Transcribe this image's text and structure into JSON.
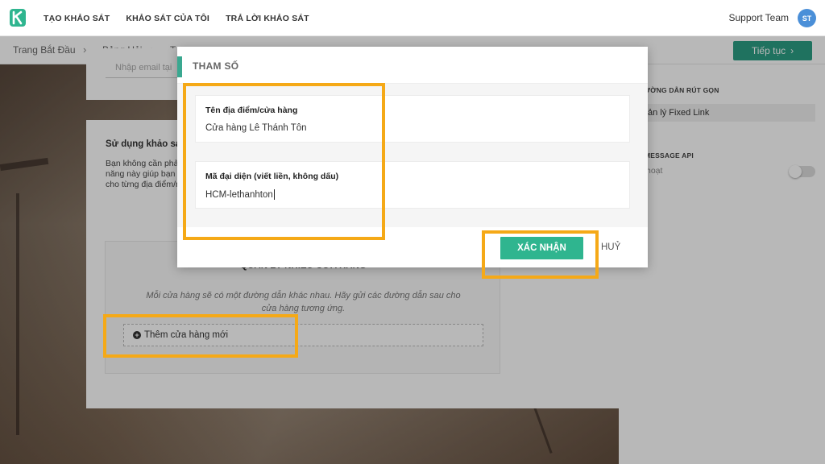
{
  "nav": {
    "logo_letter": "K",
    "links": [
      "TẠO KHẢO SÁT",
      "KHẢO SÁT CỦA TÔI",
      "TRẢ LỜI KHẢO SÁT"
    ],
    "user_name": "Support Team",
    "avatar_initials": "ST"
  },
  "breadcrumb": {
    "items": [
      "Trang Bắt Đầu",
      "Bảng Hỏi",
      "T"
    ],
    "separator": "›",
    "next_label": "Tiếp tục",
    "next_icon": "chevron-right-icon"
  },
  "background_card": {
    "email_placeholder": "Nhập email tại",
    "section_title": "Sử dụng khảo sát",
    "section_desc": [
      "Bạn không cần phải",
      "năng này giúp bạn c",
      "cho từng địa điểm/n"
    ],
    "stores_title": "QUẢN LÝ NHIỀU CỬA HÀNG",
    "stores_desc": "Mỗi cửa hàng sẽ có một đường dẫn khác nhau. Hãy gửi các đường dẫn sau cho cửa hàng tương ứng.",
    "add_store_label": "Thêm cửa hàng mới"
  },
  "right_panel": {
    "short_link_label": "ƯỜNG DẪN RÚT GỌN",
    "short_link_value": "ản lý Fixed Link",
    "api_label": "MESSAGE API",
    "api_status": "hoạt"
  },
  "modal": {
    "title": "THAM SỐ",
    "fields": [
      {
        "label": "Tên địa điểm/cửa hàng",
        "value": "Cửa hàng Lê Thánh Tôn"
      },
      {
        "label": "Mã đại diện (viết liền, không dấu)",
        "value": "HCM-lethanhton"
      }
    ],
    "confirm_label": "XÁC NHẬN",
    "cancel_label": "HUỶ"
  },
  "colors": {
    "accent": "#2fb58f",
    "highlight": "#f5a917",
    "avatar": "#4a8fd8"
  }
}
